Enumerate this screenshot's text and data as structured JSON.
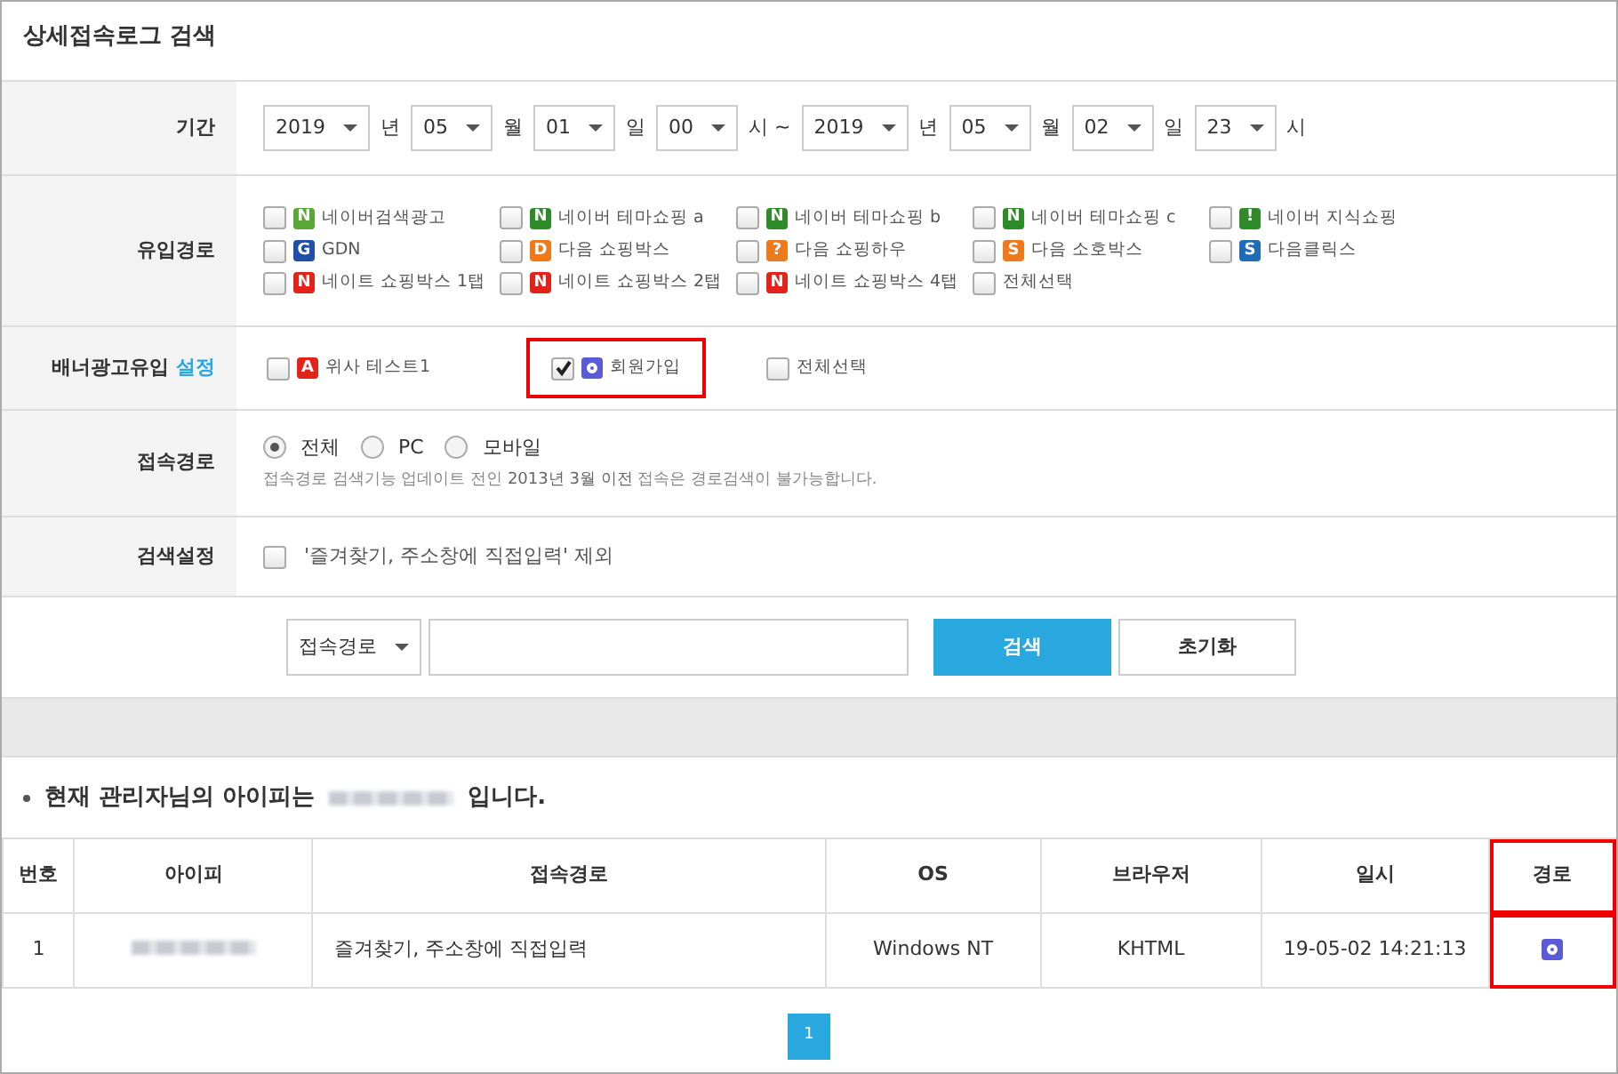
{
  "title": "상세접속로그 검색",
  "period": {
    "label": "기간",
    "parts": [
      {
        "value": "2019",
        "unit": "년"
      },
      {
        "value": "05",
        "unit": "월"
      },
      {
        "value": "01",
        "unit": "일"
      },
      {
        "value": "00",
        "unit": "시 ~"
      },
      {
        "value": "2019",
        "unit": "년"
      },
      {
        "value": "05",
        "unit": "월"
      },
      {
        "value": "02",
        "unit": "일"
      },
      {
        "value": "23",
        "unit": "시"
      }
    ]
  },
  "sources": {
    "label": "유입경로",
    "items": [
      {
        "label": "네이버검색광고",
        "checked": false,
        "badge": "N",
        "color": "#5aa636"
      },
      {
        "label": "네이버 테마쇼핑 a",
        "checked": false,
        "badge": "N",
        "color": "#2f8a2a"
      },
      {
        "label": "네이버 테마쇼핑 b",
        "checked": false,
        "badge": "N",
        "color": "#2f8a2a"
      },
      {
        "label": "네이버 테마쇼핑 c",
        "checked": false,
        "badge": "N",
        "color": "#2f8a2a"
      },
      {
        "label": "네이버 지식쇼핑",
        "checked": false,
        "badge": "!",
        "color": "#2f8a2a"
      },
      {
        "label": "GDN",
        "checked": false,
        "badge": "G",
        "color": "#1f4fa8"
      },
      {
        "label": "다음 쇼핑박스",
        "checked": false,
        "badge": "D",
        "color": "#ee7a1b"
      },
      {
        "label": "다음 쇼핑하우",
        "checked": false,
        "badge": "?",
        "color": "#ee7a1b"
      },
      {
        "label": "다음 소호박스",
        "checked": false,
        "badge": "S",
        "color": "#ee7a1b"
      },
      {
        "label": "다음클릭스",
        "checked": false,
        "badge": "S",
        "color": "#1f6bb8"
      },
      {
        "label": "네이트 쇼핑박스 1탭",
        "checked": false,
        "badge": "N",
        "color": "#e2231a"
      },
      {
        "label": "네이트 쇼핑박스 2탭",
        "checked": false,
        "badge": "N",
        "color": "#e2231a"
      },
      {
        "label": "네이트 쇼핑박스 4탭",
        "checked": false,
        "badge": "N",
        "color": "#e2231a"
      },
      {
        "label": "전체선택",
        "checked": false
      }
    ]
  },
  "banner": {
    "label": "배너광고유입",
    "link": "설정",
    "items": [
      {
        "label": "위사 테스트1",
        "checked": false,
        "badge": "A",
        "color": "#e2231a",
        "highlighted": false
      },
      {
        "label": "회원가입",
        "checked": true,
        "kind": "ring",
        "color": "#5b5bd6",
        "highlighted": true
      },
      {
        "label": "전체선택",
        "checked": false,
        "highlighted": false
      }
    ]
  },
  "access": {
    "label": "접속경로",
    "options": [
      {
        "label": "전체",
        "selected": true
      },
      {
        "label": "PC",
        "selected": false
      },
      {
        "label": "모바일",
        "selected": false
      }
    ],
    "note_before": "접속경로 검색기능 업데이트 전인 ",
    "note_link": "2013년 3월 이전",
    "note_after": " 접속은 경로검색이 불가능합니다."
  },
  "search_setting": {
    "label": "검색설정",
    "option": {
      "label": "'즐겨찾기, 주소창에 직접입력' 제외",
      "checked": false
    }
  },
  "search_bar": {
    "select": "접속경로",
    "search_button": "검색",
    "reset_button": "초기화"
  },
  "ip_notice": {
    "before": "현재 관리자님의 아이피는",
    "after": "입니다."
  },
  "table": {
    "columns": [
      {
        "label": "번호",
        "highlighted": false
      },
      {
        "label": "아이피",
        "highlighted": false
      },
      {
        "label": "접속경로",
        "highlighted": false
      },
      {
        "label": "OS",
        "highlighted": false
      },
      {
        "label": "브라우저",
        "highlighted": false
      },
      {
        "label": "일시",
        "highlighted": false
      },
      {
        "label": "경로",
        "highlighted": true
      }
    ],
    "rows": [
      {
        "no": "1",
        "path": "즐겨찾기, 주소창에 직접입력",
        "os": "Windows NT",
        "browser": "KHTML",
        "datetime": "19-05-02 14:21:13",
        "route": {
          "kind": "ring",
          "color": "#5b5bd6"
        }
      }
    ]
  },
  "pagination": [
    {
      "label": "1",
      "selected": true
    }
  ]
}
